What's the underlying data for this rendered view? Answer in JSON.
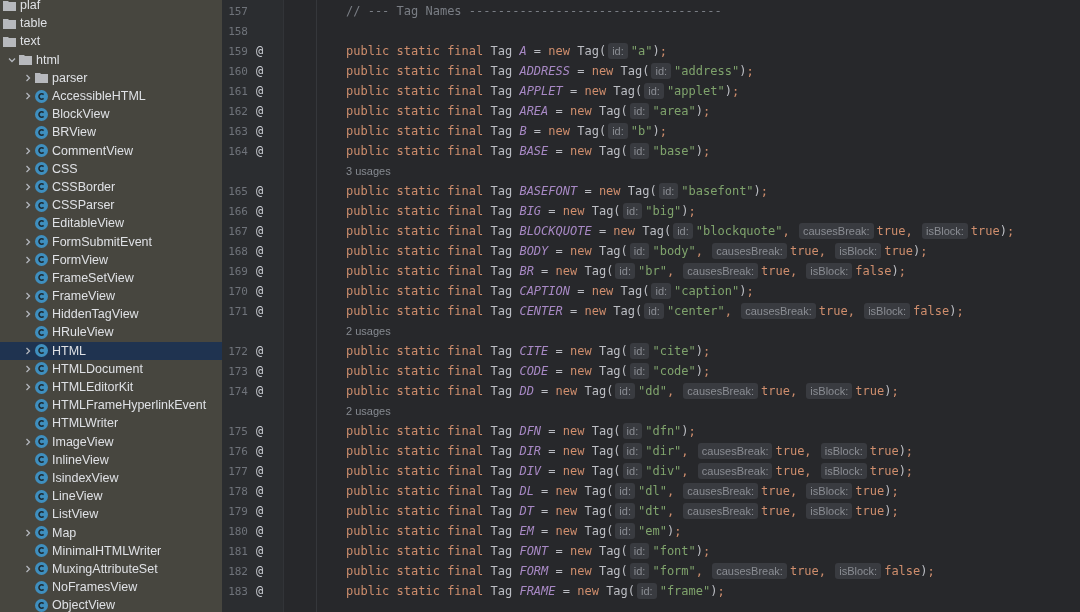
{
  "project_tree": {
    "items": [
      {
        "label": "plaf",
        "kind": "folder",
        "selected": false
      },
      {
        "label": "table",
        "kind": "folder",
        "selected": false
      },
      {
        "label": "text",
        "kind": "folder",
        "selected": false,
        "children": [
          {
            "label": "html",
            "kind": "folder",
            "has_children": true,
            "expanded": true,
            "selected": false,
            "children": [
              {
                "label": "parser",
                "kind": "folder",
                "has_children": true,
                "expanded": false,
                "selected": false
              },
              {
                "label": "AccessibleHTML",
                "kind": "class",
                "has_children": true,
                "expanded": false,
                "selected": false
              },
              {
                "label": "BlockView",
                "kind": "class",
                "has_children": false,
                "selected": false
              },
              {
                "label": "BRView",
                "kind": "class",
                "has_children": false,
                "selected": false
              },
              {
                "label": "CommentView",
                "kind": "class",
                "has_children": true,
                "expanded": false,
                "selected": false
              },
              {
                "label": "CSS",
                "kind": "class",
                "has_children": true,
                "expanded": false,
                "selected": false
              },
              {
                "label": "CSSBorder",
                "kind": "class",
                "has_children": true,
                "expanded": false,
                "selected": false
              },
              {
                "label": "CSSParser",
                "kind": "class",
                "has_children": true,
                "expanded": false,
                "selected": false
              },
              {
                "label": "EditableView",
                "kind": "class",
                "has_children": false,
                "selected": false
              },
              {
                "label": "FormSubmitEvent",
                "kind": "class",
                "has_children": true,
                "expanded": false,
                "selected": false
              },
              {
                "label": "FormView",
                "kind": "class",
                "has_children": true,
                "expanded": false,
                "selected": false
              },
              {
                "label": "FrameSetView",
                "kind": "class",
                "has_children": false,
                "selected": false
              },
              {
                "label": "FrameView",
                "kind": "class",
                "has_children": true,
                "expanded": false,
                "selected": false
              },
              {
                "label": "HiddenTagView",
                "kind": "class",
                "has_children": true,
                "expanded": false,
                "selected": false
              },
              {
                "label": "HRuleView",
                "kind": "class",
                "has_children": false,
                "selected": false
              },
              {
                "label": "HTML",
                "kind": "class",
                "has_children": true,
                "expanded": false,
                "selected": true
              },
              {
                "label": "HTMLDocument",
                "kind": "class",
                "has_children": true,
                "expanded": false,
                "selected": false
              },
              {
                "label": "HTMLEditorKit",
                "kind": "class",
                "has_children": true,
                "expanded": false,
                "selected": false
              },
              {
                "label": "HTMLFrameHyperlinkEvent",
                "kind": "class",
                "has_children": false,
                "selected": false
              },
              {
                "label": "HTMLWriter",
                "kind": "class",
                "has_children": false,
                "selected": false
              },
              {
                "label": "ImageView",
                "kind": "class",
                "has_children": true,
                "expanded": false,
                "selected": false
              },
              {
                "label": "InlineView",
                "kind": "class",
                "has_children": false,
                "selected": false
              },
              {
                "label": "IsindexView",
                "kind": "class",
                "has_children": false,
                "selected": false
              },
              {
                "label": "LineView",
                "kind": "class",
                "has_children": false,
                "selected": false
              },
              {
                "label": "ListView",
                "kind": "class",
                "has_children": false,
                "selected": false
              },
              {
                "label": "Map",
                "kind": "class",
                "has_children": true,
                "expanded": false,
                "selected": false
              },
              {
                "label": "MinimalHTMLWriter",
                "kind": "class",
                "has_children": false,
                "selected": false
              },
              {
                "label": "MuxingAttributeSet",
                "kind": "class",
                "has_children": true,
                "expanded": false,
                "selected": false
              },
              {
                "label": "NoFramesView",
                "kind": "class",
                "has_children": false,
                "selected": false
              },
              {
                "label": "ObjectView",
                "kind": "class",
                "has_children": false,
                "selected": false
              }
            ]
          }
        ]
      }
    ]
  },
  "editor": {
    "lines": [
      {
        "kind": "comment",
        "num": "157",
        "text": "// --- Tag Names -----------------------------------"
      },
      {
        "kind": "blank",
        "num": "158"
      },
      {
        "kind": "code",
        "num": "159",
        "mark": "@",
        "segs": [
          {
            "kind": "kw",
            "t": "public static final "
          },
          {
            "kind": "plain",
            "t": "Tag "
          },
          {
            "kind": "name",
            "t": "A"
          },
          {
            "kind": "plain",
            "t": " = "
          },
          {
            "kind": "kw",
            "t": "new "
          },
          {
            "kind": "plain",
            "t": "Tag("
          },
          {
            "kind": "hint",
            "t": "id:"
          },
          {
            "kind": "str",
            "t": "\"a\""
          },
          {
            "kind": "plain",
            "t": ")"
          },
          {
            "kind": "kw",
            "t": ";"
          }
        ]
      },
      {
        "kind": "code",
        "num": "160",
        "mark": "@",
        "segs": [
          {
            "kind": "kw",
            "t": "public static final "
          },
          {
            "kind": "plain",
            "t": "Tag "
          },
          {
            "kind": "name",
            "t": "ADDRESS"
          },
          {
            "kind": "plain",
            "t": " = "
          },
          {
            "kind": "kw",
            "t": "new "
          },
          {
            "kind": "plain",
            "t": "Tag("
          },
          {
            "kind": "hint",
            "t": "id:"
          },
          {
            "kind": "str",
            "t": "\"address\""
          },
          {
            "kind": "plain",
            "t": ")"
          },
          {
            "kind": "kw",
            "t": ";"
          }
        ]
      },
      {
        "kind": "code",
        "num": "161",
        "mark": "@",
        "segs": [
          {
            "kind": "kw",
            "t": "public static final "
          },
          {
            "kind": "plain",
            "t": "Tag "
          },
          {
            "kind": "name",
            "t": "APPLET"
          },
          {
            "kind": "plain",
            "t": " = "
          },
          {
            "kind": "kw",
            "t": "new "
          },
          {
            "kind": "plain",
            "t": "Tag("
          },
          {
            "kind": "hint",
            "t": "id:"
          },
          {
            "kind": "str",
            "t": "\"applet\""
          },
          {
            "kind": "plain",
            "t": ")"
          },
          {
            "kind": "kw",
            "t": ";"
          }
        ]
      },
      {
        "kind": "code",
        "num": "162",
        "mark": "@",
        "segs": [
          {
            "kind": "kw",
            "t": "public static final "
          },
          {
            "kind": "plain",
            "t": "Tag "
          },
          {
            "kind": "name",
            "t": "AREA"
          },
          {
            "kind": "plain",
            "t": " = "
          },
          {
            "kind": "kw",
            "t": "new "
          },
          {
            "kind": "plain",
            "t": "Tag("
          },
          {
            "kind": "hint",
            "t": "id:"
          },
          {
            "kind": "str",
            "t": "\"area\""
          },
          {
            "kind": "plain",
            "t": ")"
          },
          {
            "kind": "kw",
            "t": ";"
          }
        ]
      },
      {
        "kind": "code",
        "num": "163",
        "mark": "@",
        "segs": [
          {
            "kind": "kw",
            "t": "public static final "
          },
          {
            "kind": "plain",
            "t": "Tag "
          },
          {
            "kind": "name",
            "t": "B"
          },
          {
            "kind": "plain",
            "t": " = "
          },
          {
            "kind": "kw",
            "t": "new "
          },
          {
            "kind": "plain",
            "t": "Tag("
          },
          {
            "kind": "hint",
            "t": "id:"
          },
          {
            "kind": "str",
            "t": "\"b\""
          },
          {
            "kind": "plain",
            "t": ")"
          },
          {
            "kind": "kw",
            "t": ";"
          }
        ]
      },
      {
        "kind": "code",
        "num": "164",
        "mark": "@",
        "segs": [
          {
            "kind": "kw",
            "t": "public static final "
          },
          {
            "kind": "plain",
            "t": "Tag "
          },
          {
            "kind": "name",
            "t": "BASE"
          },
          {
            "kind": "plain",
            "t": " = "
          },
          {
            "kind": "kw",
            "t": "new "
          },
          {
            "kind": "plain",
            "t": "Tag("
          },
          {
            "kind": "hint",
            "t": "id:"
          },
          {
            "kind": "str",
            "t": "\"base\""
          },
          {
            "kind": "plain",
            "t": ")"
          },
          {
            "kind": "kw",
            "t": ";"
          }
        ]
      },
      {
        "kind": "usages",
        "text": "3 usages"
      },
      {
        "kind": "code",
        "num": "165",
        "mark": "@",
        "segs": [
          {
            "kind": "kw",
            "t": "public static final "
          },
          {
            "kind": "plain",
            "t": "Tag "
          },
          {
            "kind": "name",
            "t": "BASEFONT"
          },
          {
            "kind": "plain",
            "t": " = "
          },
          {
            "kind": "kw",
            "t": "new "
          },
          {
            "kind": "plain",
            "t": "Tag("
          },
          {
            "kind": "hint",
            "t": "id:"
          },
          {
            "kind": "str",
            "t": "\"basefont\""
          },
          {
            "kind": "plain",
            "t": ")"
          },
          {
            "kind": "kw",
            "t": ";"
          }
        ]
      },
      {
        "kind": "code",
        "num": "166",
        "mark": "@",
        "segs": [
          {
            "kind": "kw",
            "t": "public static final "
          },
          {
            "kind": "plain",
            "t": "Tag "
          },
          {
            "kind": "name",
            "t": "BIG"
          },
          {
            "kind": "plain",
            "t": " = "
          },
          {
            "kind": "kw",
            "t": "new "
          },
          {
            "kind": "plain",
            "t": "Tag("
          },
          {
            "kind": "hint",
            "t": "id:"
          },
          {
            "kind": "str",
            "t": "\"big\""
          },
          {
            "kind": "plain",
            "t": ")"
          },
          {
            "kind": "kw",
            "t": ";"
          }
        ]
      },
      {
        "kind": "code",
        "num": "167",
        "mark": "@",
        "segs": [
          {
            "kind": "kw",
            "t": "public static final "
          },
          {
            "kind": "plain",
            "t": "Tag "
          },
          {
            "kind": "name",
            "t": "BLOCKQUOTE"
          },
          {
            "kind": "plain",
            "t": " = "
          },
          {
            "kind": "kw",
            "t": "new "
          },
          {
            "kind": "plain",
            "t": "Tag("
          },
          {
            "kind": "hint",
            "t": "id:"
          },
          {
            "kind": "str",
            "t": "\"blockquote\""
          },
          {
            "kind": "kw",
            "t": ", "
          },
          {
            "kind": "hint",
            "t": "causesBreak:"
          },
          {
            "kind": "kw",
            "t": "true, "
          },
          {
            "kind": "hint",
            "t": "isBlock:"
          },
          {
            "kind": "kw",
            "t": "true"
          },
          {
            "kind": "plain",
            "t": ")"
          },
          {
            "kind": "kw",
            "t": ";"
          }
        ]
      },
      {
        "kind": "code",
        "num": "168",
        "mark": "@",
        "segs": [
          {
            "kind": "kw",
            "t": "public static final "
          },
          {
            "kind": "plain",
            "t": "Tag "
          },
          {
            "kind": "name",
            "t": "BODY"
          },
          {
            "kind": "plain",
            "t": " = "
          },
          {
            "kind": "kw",
            "t": "new "
          },
          {
            "kind": "plain",
            "t": "Tag("
          },
          {
            "kind": "hint",
            "t": "id:"
          },
          {
            "kind": "str",
            "t": "\"body\""
          },
          {
            "kind": "kw",
            "t": ", "
          },
          {
            "kind": "hint",
            "t": "causesBreak:"
          },
          {
            "kind": "kw",
            "t": "true, "
          },
          {
            "kind": "hint",
            "t": "isBlock:"
          },
          {
            "kind": "kw",
            "t": "true"
          },
          {
            "kind": "plain",
            "t": ")"
          },
          {
            "kind": "kw",
            "t": ";"
          }
        ]
      },
      {
        "kind": "code",
        "num": "169",
        "mark": "@",
        "segs": [
          {
            "kind": "kw",
            "t": "public static final "
          },
          {
            "kind": "plain",
            "t": "Tag "
          },
          {
            "kind": "name",
            "t": "BR"
          },
          {
            "kind": "plain",
            "t": " = "
          },
          {
            "kind": "kw",
            "t": "new "
          },
          {
            "kind": "plain",
            "t": "Tag("
          },
          {
            "kind": "hint",
            "t": "id:"
          },
          {
            "kind": "str",
            "t": "\"br\""
          },
          {
            "kind": "kw",
            "t": ", "
          },
          {
            "kind": "hint",
            "t": "causesBreak:"
          },
          {
            "kind": "kw",
            "t": "true, "
          },
          {
            "kind": "hint",
            "t": "isBlock:"
          },
          {
            "kind": "kw",
            "t": "false"
          },
          {
            "kind": "plain",
            "t": ")"
          },
          {
            "kind": "kw",
            "t": ";"
          }
        ]
      },
      {
        "kind": "code",
        "num": "170",
        "mark": "@",
        "segs": [
          {
            "kind": "kw",
            "t": "public static final "
          },
          {
            "kind": "plain",
            "t": "Tag "
          },
          {
            "kind": "name",
            "t": "CAPTION"
          },
          {
            "kind": "plain",
            "t": " = "
          },
          {
            "kind": "kw",
            "t": "new "
          },
          {
            "kind": "plain",
            "t": "Tag("
          },
          {
            "kind": "hint",
            "t": "id:"
          },
          {
            "kind": "str",
            "t": "\"caption\""
          },
          {
            "kind": "plain",
            "t": ")"
          },
          {
            "kind": "kw",
            "t": ";"
          }
        ]
      },
      {
        "kind": "code",
        "num": "171",
        "mark": "@",
        "segs": [
          {
            "kind": "kw",
            "t": "public static final "
          },
          {
            "kind": "plain",
            "t": "Tag "
          },
          {
            "kind": "name",
            "t": "CENTER"
          },
          {
            "kind": "plain",
            "t": " = "
          },
          {
            "kind": "kw",
            "t": "new "
          },
          {
            "kind": "plain",
            "t": "Tag("
          },
          {
            "kind": "hint",
            "t": "id:"
          },
          {
            "kind": "str",
            "t": "\"center\""
          },
          {
            "kind": "kw",
            "t": ", "
          },
          {
            "kind": "hint",
            "t": "causesBreak:"
          },
          {
            "kind": "kw",
            "t": "true, "
          },
          {
            "kind": "hint",
            "t": "isBlock:"
          },
          {
            "kind": "kw",
            "t": "false"
          },
          {
            "kind": "plain",
            "t": ")"
          },
          {
            "kind": "kw",
            "t": ";"
          }
        ]
      },
      {
        "kind": "usages",
        "text": "2 usages"
      },
      {
        "kind": "code",
        "num": "172",
        "mark": "@",
        "segs": [
          {
            "kind": "kw",
            "t": "public static final "
          },
          {
            "kind": "plain",
            "t": "Tag "
          },
          {
            "kind": "name",
            "t": "CITE"
          },
          {
            "kind": "plain",
            "t": " = "
          },
          {
            "kind": "kw",
            "t": "new "
          },
          {
            "kind": "plain",
            "t": "Tag("
          },
          {
            "kind": "hint",
            "t": "id:"
          },
          {
            "kind": "str",
            "t": "\"cite\""
          },
          {
            "kind": "plain",
            "t": ")"
          },
          {
            "kind": "kw",
            "t": ";"
          }
        ]
      },
      {
        "kind": "code",
        "num": "173",
        "mark": "@",
        "segs": [
          {
            "kind": "kw",
            "t": "public static final "
          },
          {
            "kind": "plain",
            "t": "Tag "
          },
          {
            "kind": "name",
            "t": "CODE"
          },
          {
            "kind": "plain",
            "t": " = "
          },
          {
            "kind": "kw",
            "t": "new "
          },
          {
            "kind": "plain",
            "t": "Tag("
          },
          {
            "kind": "hint",
            "t": "id:"
          },
          {
            "kind": "str",
            "t": "\"code\""
          },
          {
            "kind": "plain",
            "t": ")"
          },
          {
            "kind": "kw",
            "t": ";"
          }
        ]
      },
      {
        "kind": "code",
        "num": "174",
        "mark": "@",
        "segs": [
          {
            "kind": "kw",
            "t": "public static final "
          },
          {
            "kind": "plain",
            "t": "Tag "
          },
          {
            "kind": "name",
            "t": "DD"
          },
          {
            "kind": "plain",
            "t": " = "
          },
          {
            "kind": "kw",
            "t": "new "
          },
          {
            "kind": "plain",
            "t": "Tag("
          },
          {
            "kind": "hint",
            "t": "id:"
          },
          {
            "kind": "str",
            "t": "\"dd\""
          },
          {
            "kind": "kw",
            "t": ", "
          },
          {
            "kind": "hint",
            "t": "causesBreak:"
          },
          {
            "kind": "kw",
            "t": "true, "
          },
          {
            "kind": "hint",
            "t": "isBlock:"
          },
          {
            "kind": "kw",
            "t": "true"
          },
          {
            "kind": "plain",
            "t": ")"
          },
          {
            "kind": "kw",
            "t": ";"
          }
        ]
      },
      {
        "kind": "usages",
        "text": "2 usages"
      },
      {
        "kind": "code",
        "num": "175",
        "mark": "@",
        "segs": [
          {
            "kind": "kw",
            "t": "public static final "
          },
          {
            "kind": "plain",
            "t": "Tag "
          },
          {
            "kind": "name",
            "t": "DFN"
          },
          {
            "kind": "plain",
            "t": " = "
          },
          {
            "kind": "kw",
            "t": "new "
          },
          {
            "kind": "plain",
            "t": "Tag("
          },
          {
            "kind": "hint",
            "t": "id:"
          },
          {
            "kind": "str",
            "t": "\"dfn\""
          },
          {
            "kind": "plain",
            "t": ")"
          },
          {
            "kind": "kw",
            "t": ";"
          }
        ]
      },
      {
        "kind": "code",
        "num": "176",
        "mark": "@",
        "segs": [
          {
            "kind": "kw",
            "t": "public static final "
          },
          {
            "kind": "plain",
            "t": "Tag "
          },
          {
            "kind": "name",
            "t": "DIR"
          },
          {
            "kind": "plain",
            "t": " = "
          },
          {
            "kind": "kw",
            "t": "new "
          },
          {
            "kind": "plain",
            "t": "Tag("
          },
          {
            "kind": "hint",
            "t": "id:"
          },
          {
            "kind": "str",
            "t": "\"dir\""
          },
          {
            "kind": "kw",
            "t": ", "
          },
          {
            "kind": "hint",
            "t": "causesBreak:"
          },
          {
            "kind": "kw",
            "t": "true, "
          },
          {
            "kind": "hint",
            "t": "isBlock:"
          },
          {
            "kind": "kw",
            "t": "true"
          },
          {
            "kind": "plain",
            "t": ")"
          },
          {
            "kind": "kw",
            "t": ";"
          }
        ]
      },
      {
        "kind": "code",
        "num": "177",
        "mark": "@",
        "segs": [
          {
            "kind": "kw",
            "t": "public static final "
          },
          {
            "kind": "plain",
            "t": "Tag "
          },
          {
            "kind": "name",
            "t": "DIV"
          },
          {
            "kind": "plain",
            "t": " = "
          },
          {
            "kind": "kw",
            "t": "new "
          },
          {
            "kind": "plain",
            "t": "Tag("
          },
          {
            "kind": "hint",
            "t": "id:"
          },
          {
            "kind": "str",
            "t": "\"div\""
          },
          {
            "kind": "kw",
            "t": ", "
          },
          {
            "kind": "hint",
            "t": "causesBreak:"
          },
          {
            "kind": "kw",
            "t": "true, "
          },
          {
            "kind": "hint",
            "t": "isBlock:"
          },
          {
            "kind": "kw",
            "t": "true"
          },
          {
            "kind": "plain",
            "t": ")"
          },
          {
            "kind": "kw",
            "t": ";"
          }
        ]
      },
      {
        "kind": "code",
        "num": "178",
        "mark": "@",
        "segs": [
          {
            "kind": "kw",
            "t": "public static final "
          },
          {
            "kind": "plain",
            "t": "Tag "
          },
          {
            "kind": "name",
            "t": "DL"
          },
          {
            "kind": "plain",
            "t": " = "
          },
          {
            "kind": "kw",
            "t": "new "
          },
          {
            "kind": "plain",
            "t": "Tag("
          },
          {
            "kind": "hint",
            "t": "id:"
          },
          {
            "kind": "str",
            "t": "\"dl\""
          },
          {
            "kind": "kw",
            "t": ", "
          },
          {
            "kind": "hint",
            "t": "causesBreak:"
          },
          {
            "kind": "kw",
            "t": "true, "
          },
          {
            "kind": "hint",
            "t": "isBlock:"
          },
          {
            "kind": "kw",
            "t": "true"
          },
          {
            "kind": "plain",
            "t": ")"
          },
          {
            "kind": "kw",
            "t": ";"
          }
        ]
      },
      {
        "kind": "code",
        "num": "179",
        "mark": "@",
        "segs": [
          {
            "kind": "kw",
            "t": "public static final "
          },
          {
            "kind": "plain",
            "t": "Tag "
          },
          {
            "kind": "name",
            "t": "DT"
          },
          {
            "kind": "plain",
            "t": " = "
          },
          {
            "kind": "kw",
            "t": "new "
          },
          {
            "kind": "plain",
            "t": "Tag("
          },
          {
            "kind": "hint",
            "t": "id:"
          },
          {
            "kind": "str",
            "t": "\"dt\""
          },
          {
            "kind": "kw",
            "t": ", "
          },
          {
            "kind": "hint",
            "t": "causesBreak:"
          },
          {
            "kind": "kw",
            "t": "true, "
          },
          {
            "kind": "hint",
            "t": "isBlock:"
          },
          {
            "kind": "kw",
            "t": "true"
          },
          {
            "kind": "plain",
            "t": ")"
          },
          {
            "kind": "kw",
            "t": ";"
          }
        ]
      },
      {
        "kind": "code",
        "num": "180",
        "mark": "@",
        "segs": [
          {
            "kind": "kw",
            "t": "public static final "
          },
          {
            "kind": "plain",
            "t": "Tag "
          },
          {
            "kind": "name",
            "t": "EM"
          },
          {
            "kind": "plain",
            "t": " = "
          },
          {
            "kind": "kw",
            "t": "new "
          },
          {
            "kind": "plain",
            "t": "Tag("
          },
          {
            "kind": "hint",
            "t": "id:"
          },
          {
            "kind": "str",
            "t": "\"em\""
          },
          {
            "kind": "plain",
            "t": ")"
          },
          {
            "kind": "kw",
            "t": ";"
          }
        ]
      },
      {
        "kind": "code",
        "num": "181",
        "mark": "@",
        "segs": [
          {
            "kind": "kw",
            "t": "public static final "
          },
          {
            "kind": "plain",
            "t": "Tag "
          },
          {
            "kind": "name",
            "t": "FONT"
          },
          {
            "kind": "plain",
            "t": " = "
          },
          {
            "kind": "kw",
            "t": "new "
          },
          {
            "kind": "plain",
            "t": "Tag("
          },
          {
            "kind": "hint",
            "t": "id:"
          },
          {
            "kind": "str",
            "t": "\"font\""
          },
          {
            "kind": "plain",
            "t": ")"
          },
          {
            "kind": "kw",
            "t": ";"
          }
        ]
      },
      {
        "kind": "code",
        "num": "182",
        "mark": "@",
        "segs": [
          {
            "kind": "kw",
            "t": "public static final "
          },
          {
            "kind": "plain",
            "t": "Tag "
          },
          {
            "kind": "name",
            "t": "FORM"
          },
          {
            "kind": "plain",
            "t": " = "
          },
          {
            "kind": "kw",
            "t": "new "
          },
          {
            "kind": "plain",
            "t": "Tag("
          },
          {
            "kind": "hint",
            "t": "id:"
          },
          {
            "kind": "str",
            "t": "\"form\""
          },
          {
            "kind": "kw",
            "t": ", "
          },
          {
            "kind": "hint",
            "t": "causesBreak:"
          },
          {
            "kind": "kw",
            "t": "true, "
          },
          {
            "kind": "hint",
            "t": "isBlock:"
          },
          {
            "kind": "kw",
            "t": "false"
          },
          {
            "kind": "plain",
            "t": ")"
          },
          {
            "kind": "kw",
            "t": ";"
          }
        ]
      },
      {
        "kind": "code",
        "num": "183",
        "mark": "@",
        "segs": [
          {
            "kind": "kw",
            "t": "public static final "
          },
          {
            "kind": "plain",
            "t": "Tag "
          },
          {
            "kind": "name",
            "t": "FRAME"
          },
          {
            "kind": "plain",
            "t": " = "
          },
          {
            "kind": "kw",
            "t": "new "
          },
          {
            "kind": "plain",
            "t": "Tag("
          },
          {
            "kind": "hint",
            "t": "id:"
          },
          {
            "kind": "str",
            "t": "\"frame\""
          },
          {
            "kind": "plain",
            "t": ")"
          },
          {
            "kind": "kw",
            "t": ";"
          }
        ]
      }
    ]
  }
}
